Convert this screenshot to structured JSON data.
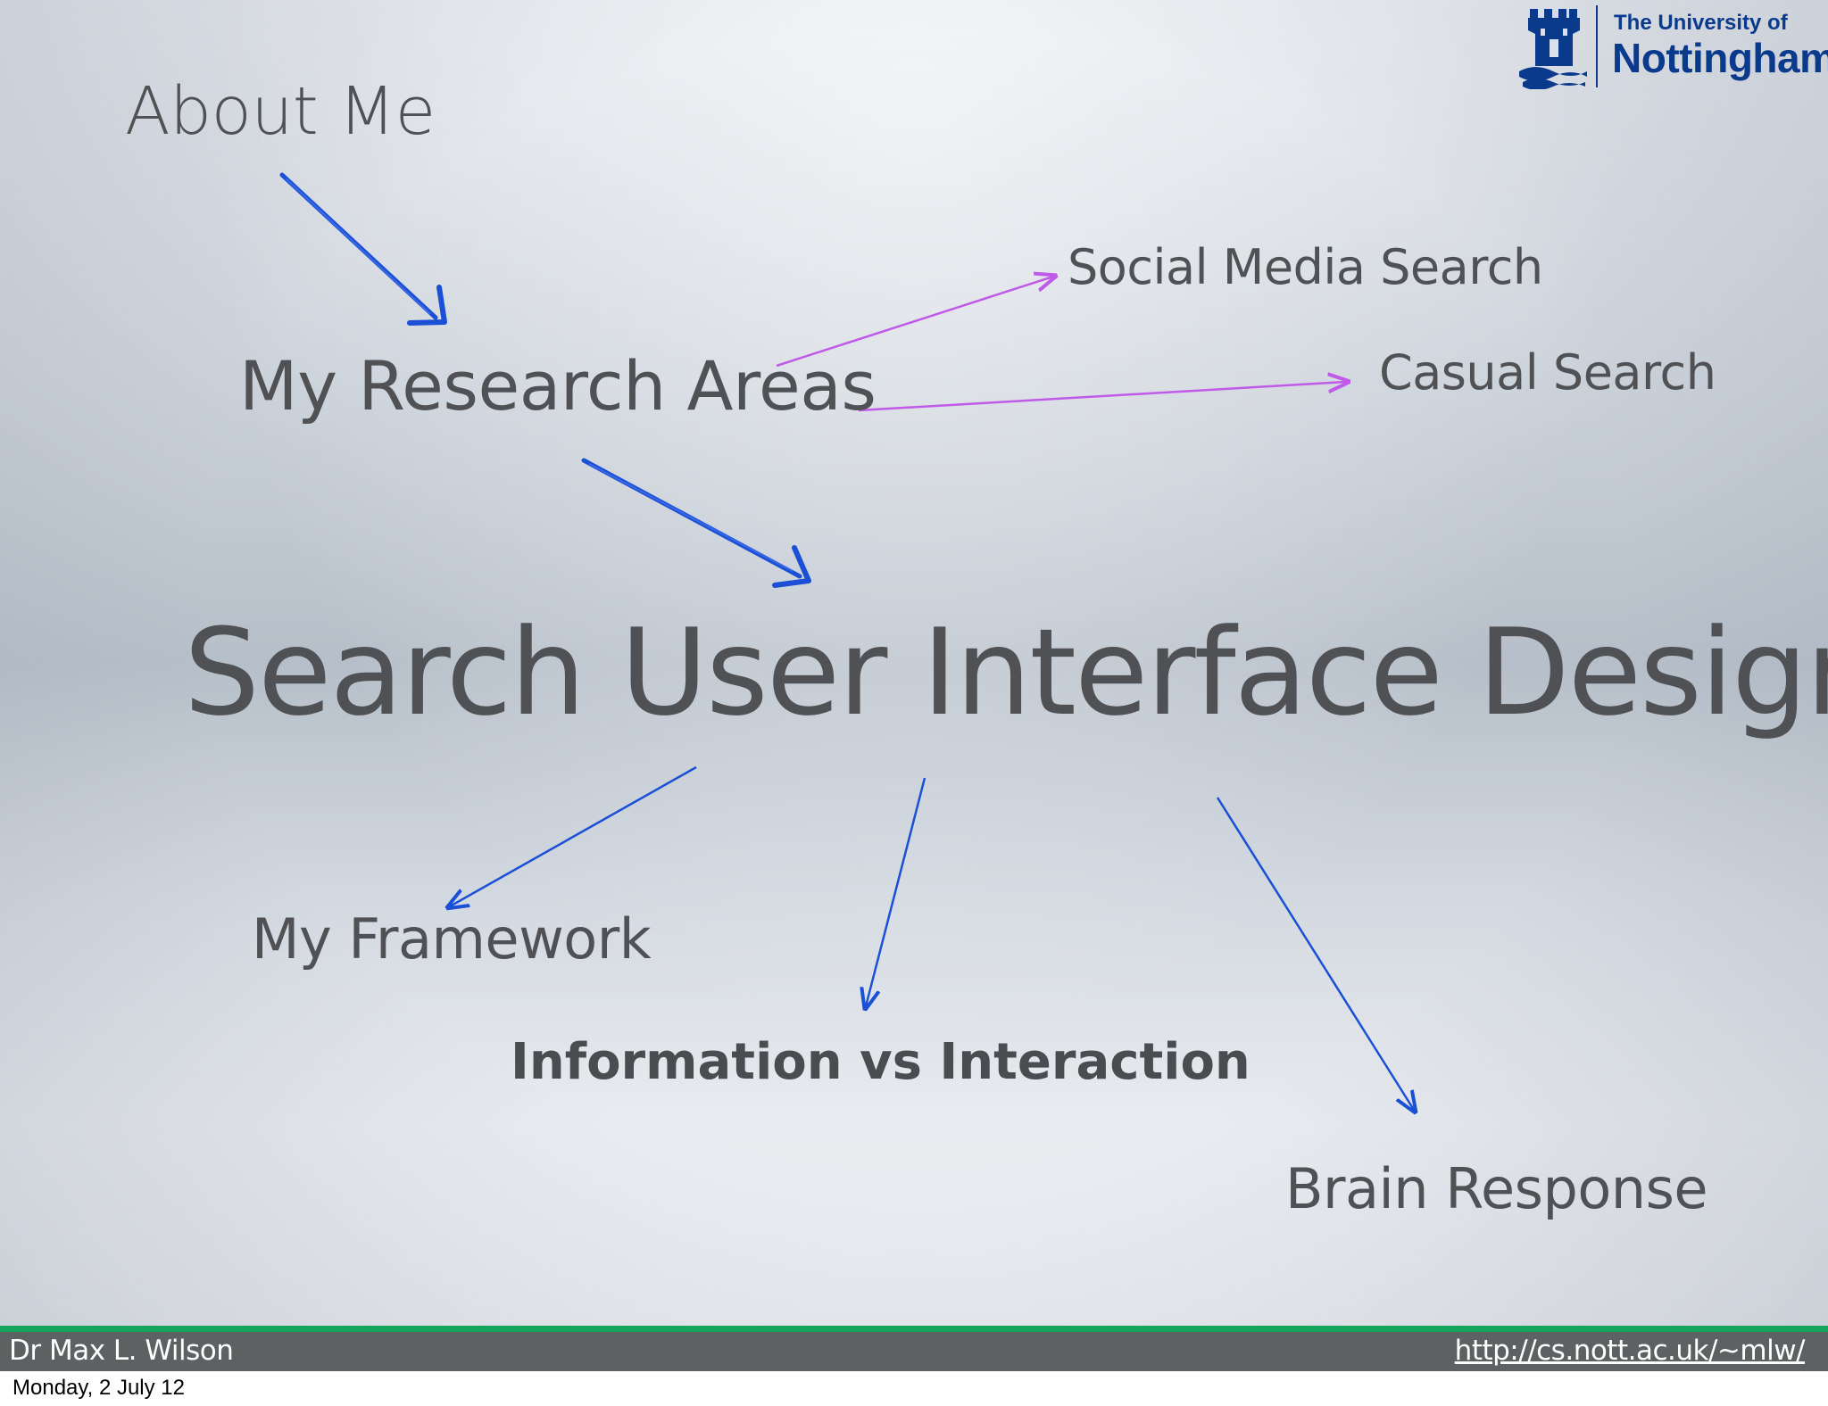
{
  "slide": {
    "about_me": "About Me",
    "research_areas": "My Research Areas",
    "social_media_search": "Social Media Search",
    "casual_search": "Casual Search",
    "main_title": "Search User Interface Design",
    "my_framework": "My Framework",
    "information_vs_interaction": "Information vs Interaction",
    "brain_response": "Brain Response"
  },
  "logo": {
    "line1": "The University of",
    "line2": "Nottingham",
    "icon": "castle-crest-icon"
  },
  "footer": {
    "author": "Dr Max L. Wilson",
    "url": "http://cs.nott.ac.uk/~mlw/"
  },
  "date_stamp": "Monday, 2 July 12",
  "colors": {
    "text": "#4f5154",
    "blue_arrow": "#1a4fd6",
    "purple_arrow": "#c05ae8",
    "logo_blue": "#0a3a8c",
    "green_bar": "#18a35a",
    "footer_bg": "#5d6162"
  }
}
